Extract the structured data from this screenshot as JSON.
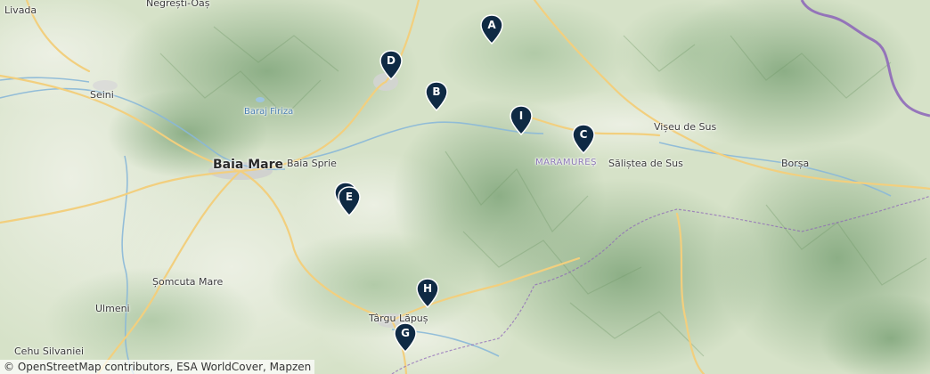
{
  "map": {
    "attribution": "© OpenStreetMap contributors, ESA WorldCover, Mapzen",
    "places": {
      "livada": "Livada",
      "negresti_oas": "Negrești-Oaș",
      "seini": "Seini",
      "baraj_firiza": "Baraj Firiza",
      "baia_mare": "Baia Mare",
      "baia_sprie": "Baia Sprie",
      "viseu_de_sus": "Vișeu de Sus",
      "maramures": "MARAMUREȘ",
      "salistea_de_sus": "Săliștea de Sus",
      "borsa": "Borșa",
      "somcuta_mare": "Șomcuta Mare",
      "ulmeni": "Ulmeni",
      "targu_lapus": "Târgu Lăpuș",
      "cehu_silvaniei": "Cehu Silvaniei"
    },
    "markers": [
      {
        "letter": "A"
      },
      {
        "letter": "B"
      },
      {
        "letter": "C"
      },
      {
        "letter": "D"
      },
      {
        "letter": "F"
      },
      {
        "letter": "E"
      },
      {
        "letter": "G"
      },
      {
        "letter": "H"
      },
      {
        "letter": "I"
      }
    ],
    "colors": {
      "marker_fill": "#0f2a44",
      "border": "#8b63b8",
      "road": "#f2cf7e",
      "river": "#8ab8d8"
    }
  }
}
